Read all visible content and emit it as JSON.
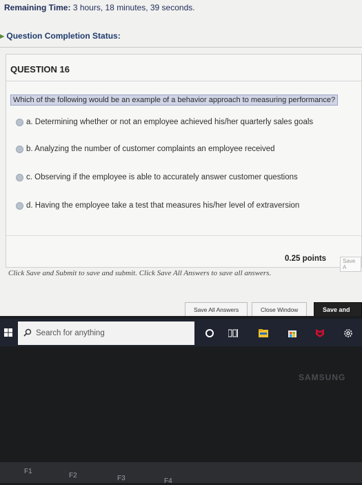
{
  "header": {
    "timer_label": "Remaining Time:",
    "timer_value": "3 hours, 18 minutes, 39 seconds.",
    "status_label": "Question Completion Status:"
  },
  "question": {
    "title": "QUESTION 16",
    "text": "Which of the following would be an example of a behavior approach to measuring performance?",
    "options": [
      "a. Determining whether or not an employee achieved his/her quarterly sales goals",
      "b. Analyzing the number of customer complaints an employee received",
      "c. Observing if the employee is able to accurately answer customer questions",
      "d. Having the employee take a test that measures his/her level of extraversion"
    ],
    "points": "0.25 points",
    "save_answer": "Save A"
  },
  "footer": {
    "instructions": "Click Save and Submit to save and submit. Click Save All Answers to save all answers.",
    "buttons": {
      "save_all": "Save All Answers",
      "close_window": "Close Window",
      "save_submit": "Save and Sub"
    }
  },
  "taskbar": {
    "search_placeholder": "Search for anything",
    "icons": [
      "windows-logo-icon",
      "search-icon",
      "cortana-icon",
      "task-view-icon",
      "file-explorer-icon",
      "store-icon",
      "mcafee-icon",
      "settings-icon"
    ],
    "colors": {
      "bar": "#1f2430",
      "accent_mcafee": "#c8102e",
      "explorer": "#f2c230"
    }
  },
  "hardware": {
    "brand": "SAMSUNG",
    "keys": [
      "F1",
      "F2",
      "F3",
      "F4"
    ]
  }
}
